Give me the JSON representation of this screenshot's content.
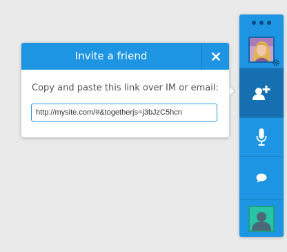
{
  "modal": {
    "title": "Invite a friend",
    "close_icon": "close-icon",
    "instructions": "Copy and paste this link over IM or email:",
    "link_value": "http://mysite.com/#&togetherjs=j3bJzC5hcn"
  },
  "dock": {
    "menu_icon": "more-dots-icon",
    "self_avatar_icon": "user-avatar-icon",
    "settings_icon": "gear-icon",
    "invite_icon": "add-user-icon",
    "mic_icon": "microphone-icon",
    "chat_icon": "chat-bubble-icon",
    "peer_avatar_icon": "peer-avatar-icon"
  },
  "colors": {
    "accent": "#1e95e2",
    "accent_dark": "#166fb0",
    "background": "#eaeaea",
    "peer_avatar": "#28c4a8"
  }
}
